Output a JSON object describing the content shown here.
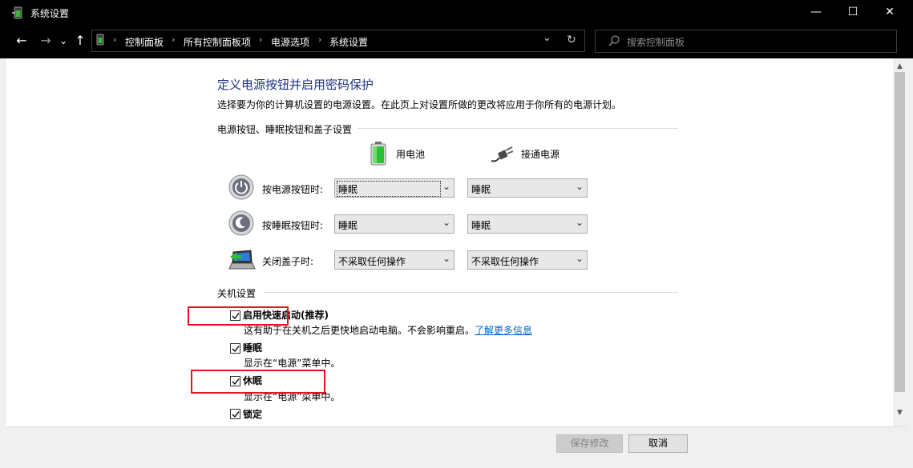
{
  "window": {
    "title": "系统设置",
    "minimize_glyph": "—",
    "maximize_glyph": "☐",
    "close_glyph": "✕"
  },
  "nav": {
    "back_glyph": "←",
    "forward_glyph": "→",
    "history_glyph": "⌄",
    "up_glyph": "↑",
    "breadcrumbs": [
      "控制面板",
      "所有控制面板项",
      "电源选项",
      "系统设置"
    ],
    "breadcrumb_sep": "›",
    "dropdown_glyph": "⌄",
    "refresh_glyph": "↻"
  },
  "search": {
    "placeholder": "搜索控制面板"
  },
  "page": {
    "title": "定义电源按钮并启用密码保护",
    "description": "选择要为你的计算机设置的电源设置。在此页上对设置所做的更改将应用于你所有的电源计划。",
    "section1": "电源按钮、睡眠按钮和盖子设置",
    "col_battery": "用电池",
    "col_plugged": "接通电源",
    "rows": [
      {
        "label": "按电源按钮时:",
        "battery": "睡眠",
        "plugged": "睡眠"
      },
      {
        "label": "按睡眠按钮时:",
        "battery": "睡眠",
        "plugged": "睡眠"
      },
      {
        "label": "关闭盖子时:",
        "battery": "不采取任何操作",
        "plugged": "不采取任何操作"
      }
    ],
    "section2": "关机设置",
    "shutdown": [
      {
        "label": "启用快速启动(推荐)",
        "checked": true,
        "desc": "这有助于在关机之后更快地启动电脑。不会影响重启。",
        "link": "了解更多信息"
      },
      {
        "label": "睡眠",
        "checked": true,
        "desc": "显示在“电源”菜单中。"
      },
      {
        "label": "休眠",
        "checked": true,
        "desc": "显示在“电源”菜单中。"
      },
      {
        "label": "锁定",
        "checked": true
      }
    ]
  },
  "footer": {
    "save_label": "保存修改",
    "cancel_label": "取消"
  },
  "colors": {
    "title_blue": "#1e3287",
    "link_blue": "#0066cc",
    "highlight_red": "#e8141c"
  }
}
